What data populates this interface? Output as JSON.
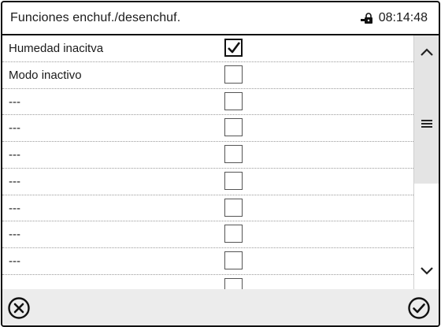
{
  "header": {
    "title": "Funciones enchuf./desenchuf.",
    "time": "08:14:48"
  },
  "rows": [
    {
      "label": "Humedad inacitva",
      "checked": true
    },
    {
      "label": "Modo inactivo",
      "checked": false
    },
    {
      "label": "---",
      "checked": false
    },
    {
      "label": "---",
      "checked": false
    },
    {
      "label": "---",
      "checked": false
    },
    {
      "label": "---",
      "checked": false
    },
    {
      "label": "---",
      "checked": false
    },
    {
      "label": "---",
      "checked": false
    },
    {
      "label": "---",
      "checked": false
    }
  ],
  "icons": {
    "status": "lock-icon",
    "cancel": "cancel-circle-icon",
    "confirm": "confirm-circle-icon",
    "scroll_up": "chevron-up-icon",
    "scroll_grip": "grip-lines-icon",
    "scroll_down": "chevron-down-icon"
  }
}
